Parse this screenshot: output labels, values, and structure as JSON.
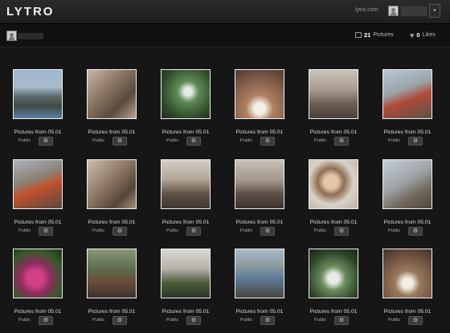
{
  "header": {
    "logo": "LYTRO",
    "site_link": "lytro.com",
    "dropdown_icon": "▾"
  },
  "profile": {
    "pictures_count": "21",
    "pictures_label": "Pictures",
    "likes_count": "0",
    "likes_label": "Likes"
  },
  "gallery": {
    "items": [
      {
        "title": "Pictures from 05.01",
        "visibility": "Public"
      },
      {
        "title": "Pictures from 05.01",
        "visibility": "Public"
      },
      {
        "title": "Pictures from 05.01",
        "visibility": "Public"
      },
      {
        "title": "Pictures from 05.01",
        "visibility": "Public"
      },
      {
        "title": "Pictures from 05.01",
        "visibility": "Public"
      },
      {
        "title": "Pictures from 05.01",
        "visibility": "Public"
      },
      {
        "title": "Pictures from 05.01",
        "visibility": "Public"
      },
      {
        "title": "Pictures from 05.01",
        "visibility": "Public"
      },
      {
        "title": "Pictures from 05.01",
        "visibility": "Public"
      },
      {
        "title": "Pictures from 05.01",
        "visibility": "Public"
      },
      {
        "title": "Pictures from 05.01",
        "visibility": "Public"
      },
      {
        "title": "Pictures from 05.01",
        "visibility": "Public"
      },
      {
        "title": "Pictures from 05.01",
        "visibility": "Public"
      },
      {
        "title": "Pictures from 05.01",
        "visibility": "Public"
      },
      {
        "title": "Pictures from 05.01",
        "visibility": "Public"
      },
      {
        "title": "Pictures from 05.01",
        "visibility": "Public"
      },
      {
        "title": "Pictures from 05.01",
        "visibility": "Public"
      },
      {
        "title": "Pictures from 05.01",
        "visibility": "Public"
      }
    ]
  },
  "icons": {
    "settings": "gear-icon",
    "pictures": "pictures-icon",
    "likes": "heart-icon",
    "avatar": "avatar-icon"
  },
  "colors": {
    "background": "#161616",
    "topbar": "#252525",
    "thumb_border": "#f1f1f1"
  }
}
